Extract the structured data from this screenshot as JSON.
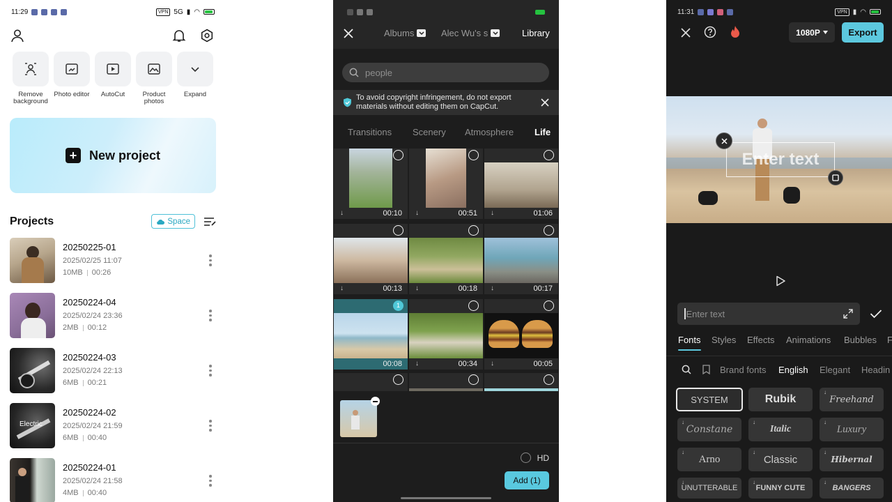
{
  "screen1": {
    "status": {
      "time": "11:29",
      "vpn": "VPN",
      "net": "5G"
    },
    "tools": [
      {
        "label": "Remove background",
        "icon": "remove-background-icon"
      },
      {
        "label": "Photo editor",
        "icon": "photo-editor-icon"
      },
      {
        "label": "AutoCut",
        "icon": "autocut-icon"
      },
      {
        "label": "Product photos",
        "icon": "product-photos-icon"
      },
      {
        "label": "Expand",
        "icon": "chevron-down-icon"
      }
    ],
    "new_project": "New project",
    "projects_title": "Projects",
    "space_label": "Space",
    "projects": [
      {
        "name": "20250225-01",
        "date": "2025/02/25 11:07",
        "size": "10MB",
        "duration": "00:26"
      },
      {
        "name": "20250224-04",
        "date": "2025/02/24 23:36",
        "size": "2MB",
        "duration": "00:12"
      },
      {
        "name": "20250224-03",
        "date": "2025/02/24 22:13",
        "size": "6MB",
        "duration": "00:21"
      },
      {
        "name": "20250224-02",
        "date": "2025/02/24 21:59",
        "size": "6MB",
        "duration": "00:40",
        "thumb_text": "Electric"
      },
      {
        "name": "20250224-01",
        "date": "2025/02/24 21:58",
        "size": "4MB",
        "duration": "00:40"
      }
    ]
  },
  "screen2": {
    "tabs": {
      "albums": "Albums",
      "account": "Alec Wu's s",
      "library": "Library"
    },
    "search_placeholder": "people",
    "notice": "To avoid copyright infringement, do not export materials without editing them on CapCut.",
    "categories": [
      "Transitions",
      "Scenery",
      "Atmosphere",
      "Life"
    ],
    "active_category": "Life",
    "clips": [
      {
        "duration": "00:10"
      },
      {
        "duration": "00:51"
      },
      {
        "duration": "01:06"
      },
      {
        "duration": "00:13"
      },
      {
        "duration": "00:18"
      },
      {
        "duration": "00:17"
      },
      {
        "duration": "00:08",
        "selected_index": "1"
      },
      {
        "duration": "00:34"
      },
      {
        "duration": "00:05"
      }
    ],
    "hd_label": "HD",
    "add_label": "Add (1)"
  },
  "screen3": {
    "status": {
      "time": "11:31",
      "vpn": "VPN"
    },
    "resolution": "1080P",
    "export_label": "Export",
    "overlay_text": "Enter text",
    "input_placeholder": "Enter text",
    "tabs": [
      "Fonts",
      "Styles",
      "Effects",
      "Animations",
      "Bubbles",
      "F"
    ],
    "font_categories": [
      "Brand fonts",
      "English",
      "Elegant",
      "Headin"
    ],
    "fonts": [
      "SYSTEM",
      "Rubik",
      "Freehand",
      "Constane",
      "Italic",
      "Luxury",
      "Arno",
      "Classic",
      "Hibernal",
      "UNUTTERABLE",
      "FUNNY CUTE",
      "BANGERS"
    ]
  },
  "colors": {
    "accent": "#5cc8de",
    "dark_bg": "#1d1d1d"
  }
}
